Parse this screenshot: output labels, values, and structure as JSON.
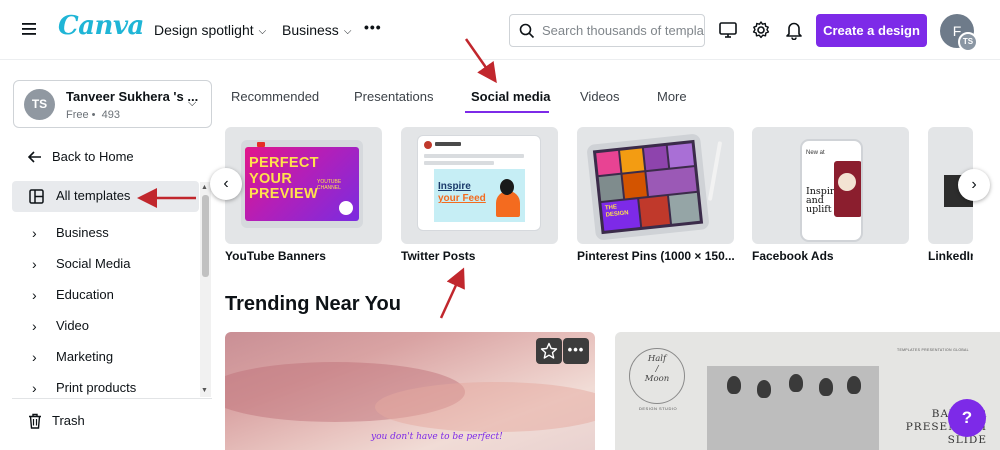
{
  "header": {
    "logo": "Canva",
    "nav": [
      {
        "label": "Design spotlight"
      },
      {
        "label": "Business"
      }
    ],
    "more_label": "•••",
    "search_placeholder": "Search thousands of templates",
    "create_label": "Create a design",
    "avatar_initial": "F",
    "avatar_team_initials": "TS"
  },
  "sidebar": {
    "team_initials": "TS",
    "team_name": "Tanveer Sukhera 's ...",
    "team_sub": "Free •  493",
    "back_label": "Back to Home",
    "all_templates_label": "All templates",
    "categories": [
      "Business",
      "Social Media",
      "Education",
      "Video",
      "Marketing",
      "Print products"
    ],
    "trash_label": "Trash"
  },
  "tabs": [
    "Recommended",
    "Presentations",
    "Social media",
    "Videos",
    "More"
  ],
  "active_tab": "Social media",
  "cards": [
    {
      "label": "YouTube Banners",
      "thumb_text": [
        "PERFECT",
        "YOUR",
        "PREVIEW"
      ],
      "thumb_small": "YOUTUBE CHANNEL"
    },
    {
      "label": "Twitter Posts",
      "thumb_text": [
        "Inspire",
        "your Feed"
      ]
    },
    {
      "label": "Pinterest Pins (1000 × 150...",
      "thumb_text": [
        "THE DESIGN"
      ]
    },
    {
      "label": "Facebook Ads",
      "thumb_text": [
        "New at",
        "Inspire",
        "and",
        "uplift"
      ]
    },
    {
      "label": "LinkedIn"
    }
  ],
  "section_title": "Trending Near You",
  "trending": [
    {
      "caption": "you don't have to be perfect!"
    },
    {
      "title_lines": [
        "Half",
        "/",
        "Moon"
      ],
      "sub": "DESIGN STUDIO",
      "banner_lines": [
        "BANNER",
        "PRESENTATI",
        "SLIDE"
      ],
      "top_small": "TEMPLATES PRESENTATION GLOBAL"
    }
  ],
  "help_label": "?",
  "colors": {
    "accent": "#7d2ae8",
    "brand": "#1fb5d6",
    "annotation": "#c1272d"
  }
}
